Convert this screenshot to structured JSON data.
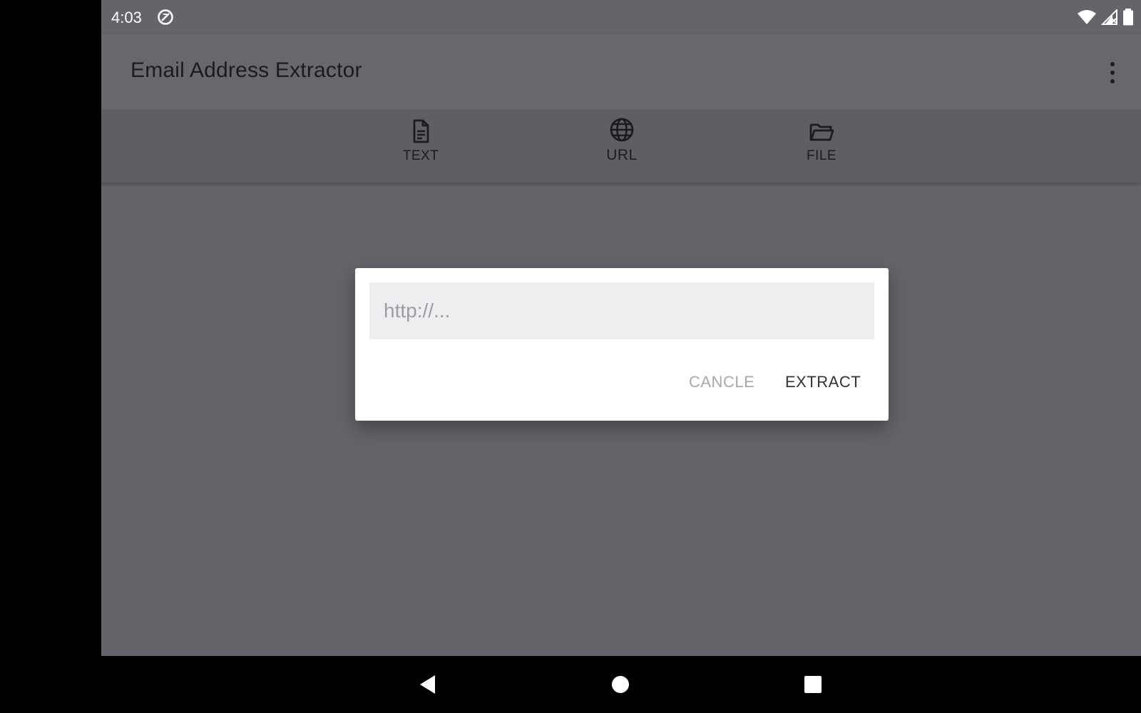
{
  "status_bar": {
    "time": "4:03"
  },
  "app_bar": {
    "title": "Email Address Extractor"
  },
  "tabs": [
    {
      "label": "TEXT",
      "icon": "document-icon"
    },
    {
      "label": "URL",
      "icon": "globe-icon"
    },
    {
      "label": "FILE",
      "icon": "folder-open-icon"
    }
  ],
  "dialog": {
    "input_placeholder": "http://...",
    "input_value": "",
    "cancel_label": "CANCLE",
    "extract_label": "EXTRACT"
  },
  "colors": {
    "scrim_background": "#66646a",
    "dialog_background": "#ffffff",
    "input_background": "#efedf0"
  }
}
